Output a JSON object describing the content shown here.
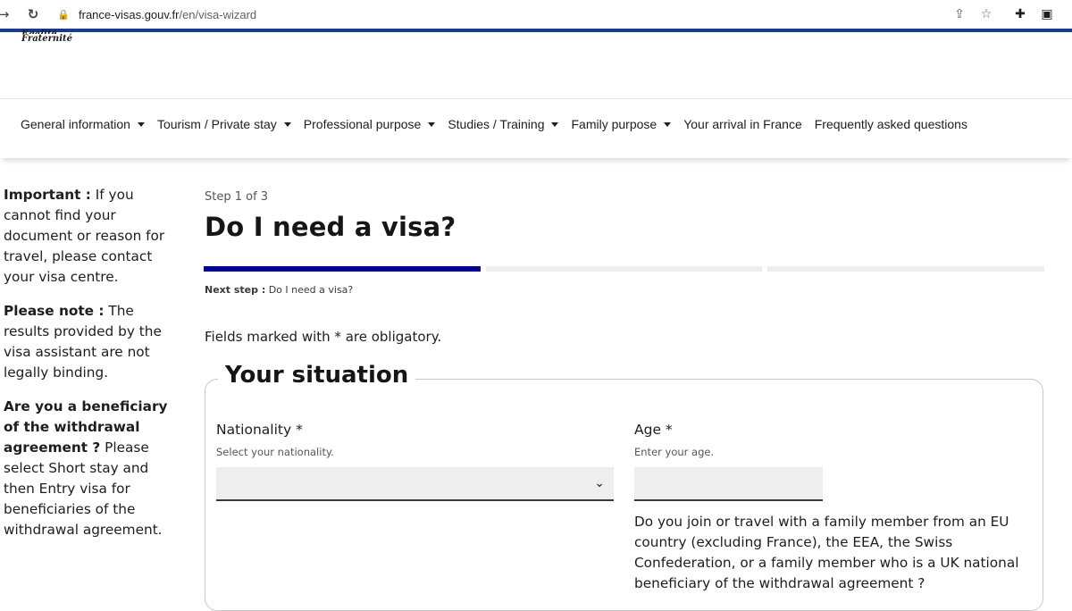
{
  "browser": {
    "url_host": "france-visas.gouv.fr",
    "url_path": "/en/visa-wizard"
  },
  "header": {
    "motto_line1": "Égalité",
    "motto_line2": "Fraternité"
  },
  "nav": {
    "items": [
      {
        "label": "General information",
        "dropdown": true
      },
      {
        "label": "Tourism / Private stay",
        "dropdown": true
      },
      {
        "label": "Professional purpose",
        "dropdown": true
      },
      {
        "label": "Studies / Training",
        "dropdown": true
      },
      {
        "label": "Family purpose",
        "dropdown": true
      },
      {
        "label": "Your arrival in France",
        "dropdown": false
      },
      {
        "label": "Frequently asked questions",
        "dropdown": false
      }
    ]
  },
  "sidebar": {
    "important_label": "Important :",
    "important_text": " If you cannot find your document or reason for travel, please contact your visa centre.",
    "note_label": "Please note :",
    "note_text": " The results provided by the visa assistant are not legally binding.",
    "beneficiary_label": "Are you a beneficiary of the withdrawal agreement ?",
    "beneficiary_text": " Please select Short stay and then Entry visa for beneficiaries of the withdrawal agreement."
  },
  "main": {
    "step_label": "Step 1 of 3",
    "title": "Do I need a visa?",
    "progress": {
      "current_step": 1,
      "total_steps": 3
    },
    "next_step_label": "Next step :",
    "next_step_value": " Do I need a visa?",
    "obligatory_note": "Fields marked with * are obligatory."
  },
  "form": {
    "legend": "Your situation",
    "nationality_label": "Nationality *",
    "nationality_hint": "Select your nationality.",
    "nationality_value": "",
    "age_label": "Age *",
    "age_hint": "Enter your age.",
    "age_value": "",
    "family_question": "Do you join or travel with a family member from an EU country (excluding France), the EEA, the Swiss Confederation, or a family member who is a UK national beneficiary of the withdrawal agreement ?"
  },
  "colors": {
    "brand_blue": "#000091",
    "chrome_accent": "#1a3a8f"
  }
}
